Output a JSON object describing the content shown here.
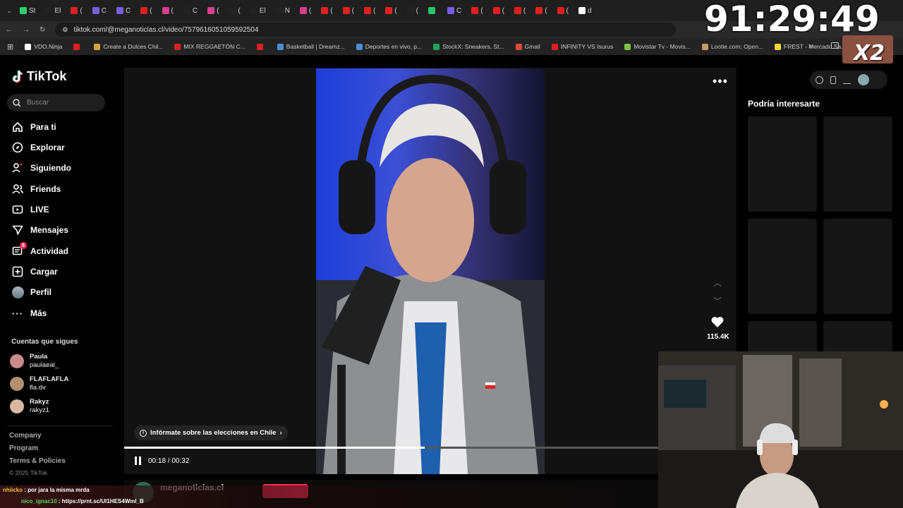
{
  "browser": {
    "tabs": [
      {
        "label": "St",
        "color": "#2ecc71"
      },
      {
        "label": "El",
        "color": "#222"
      },
      {
        "label": "(",
        "color": "#e02020"
      },
      {
        "label": "C",
        "color": "#7a5ce0"
      },
      {
        "label": "C",
        "color": "#7a5ce0"
      },
      {
        "label": "(",
        "color": "#e02020"
      },
      {
        "label": "(",
        "color": "#d63f8c"
      },
      {
        "label": "C",
        "color": "#222"
      },
      {
        "label": "(",
        "color": "#d63f8c"
      },
      {
        "label": "(",
        "color": "#222"
      },
      {
        "label": "El",
        "color": "#222"
      },
      {
        "label": "N",
        "color": "#222"
      },
      {
        "label": "(",
        "color": "#d63f8c"
      },
      {
        "label": "(",
        "color": "#e02020"
      },
      {
        "label": "(",
        "color": "#e02020"
      },
      {
        "label": "(",
        "color": "#e02020"
      },
      {
        "label": "(",
        "color": "#e02020"
      },
      {
        "label": "(",
        "color": "#222"
      },
      {
        "label": "",
        "color": "#27c46b"
      },
      {
        "label": "C",
        "color": "#7a5ce0"
      },
      {
        "label": "(",
        "color": "#e02020"
      },
      {
        "label": "(",
        "color": "#e02020"
      },
      {
        "label": "(",
        "color": "#e02020"
      },
      {
        "label": "(",
        "color": "#e02020"
      },
      {
        "label": "(",
        "color": "#e02020"
      },
      {
        "label": "d",
        "color": "#ffffff"
      }
    ],
    "url": "tiktok.com/@meganoticias.cl/video/7579616051059592504",
    "bookmarks": [
      {
        "label": "VDO.Ninja",
        "color": "#ffffff"
      },
      {
        "label": "",
        "color": "#e02020"
      },
      {
        "label": "Create a Dulces Chil...",
        "color": "#d9a23b"
      },
      {
        "label": "MIX REGGAETÓN C...",
        "color": "#e02020"
      },
      {
        "label": "",
        "color": "#e02020"
      },
      {
        "label": "Basketball | Dreamz...",
        "color": "#4a90d9"
      },
      {
        "label": "Deportes en vivo, p...",
        "color": "#4a90d9"
      },
      {
        "label": "StockX: Sneakers, St...",
        "color": "#18a558"
      },
      {
        "label": "Gmail",
        "color": "#e04a3a"
      },
      {
        "label": "INFINITY VS Isurus",
        "color": "#e02020"
      },
      {
        "label": "Movistar Tv - Movis...",
        "color": "#7fc241"
      },
      {
        "label": "Lootie.com: Open...",
        "color": "#cc9966"
      },
      {
        "label": "FREST - Mercado Sa...",
        "color": "#f5d33b"
      }
    ]
  },
  "overlay": {
    "timer": "91:29:49",
    "multiplier": "X2"
  },
  "sidebar": {
    "brand": "TikTok",
    "search_placeholder": "Buscar",
    "nav": [
      {
        "label": "Para ti",
        "icon": "home-icon"
      },
      {
        "label": "Explorar",
        "icon": "compass-icon"
      },
      {
        "label": "Siguiendo",
        "icon": "following-icon"
      },
      {
        "label": "Friends",
        "icon": "friends-icon"
      },
      {
        "label": "LIVE",
        "icon": "live-icon"
      },
      {
        "label": "Mensajes",
        "icon": "messages-icon"
      },
      {
        "label": "Actividad",
        "icon": "activity-icon",
        "badge": "5"
      },
      {
        "label": "Cargar",
        "icon": "upload-icon"
      },
      {
        "label": "Perfil",
        "icon": "avatar"
      },
      {
        "label": "Más",
        "icon": "more-icon"
      }
    ],
    "following_title": "Cuentas que sigues",
    "following": [
      {
        "name": "Paula",
        "handle": "paulaeal_",
        "color": "#c98a8a"
      },
      {
        "name": "FLAFLAFLA",
        "handle": "fla.dv",
        "color": "#b09070"
      },
      {
        "name": "Rakyz",
        "handle": "rakyz1",
        "color": "#d8b8a0"
      }
    ],
    "footer": [
      "Company",
      "Program",
      "Terms & Policies"
    ],
    "copyright": "© 2025 TikTok"
  },
  "player": {
    "info_pill": "Infórmate sobre las elecciones en Chile",
    "current_time": "00:18",
    "duration": "00:32",
    "progress": 0.5625,
    "likes": "115.4K",
    "username": "meganoticias.cl"
  },
  "recommend": {
    "title": "Podría interesarte"
  },
  "chat": [
    {
      "user": "nhiicko",
      "text": "por jara la misma mrda",
      "color": "#f0c040"
    },
    {
      "user": "nico_ignac10",
      "text": "https://prnt.sc/Ul1HES4Wml_B",
      "color": "#5fd35f"
    }
  ]
}
